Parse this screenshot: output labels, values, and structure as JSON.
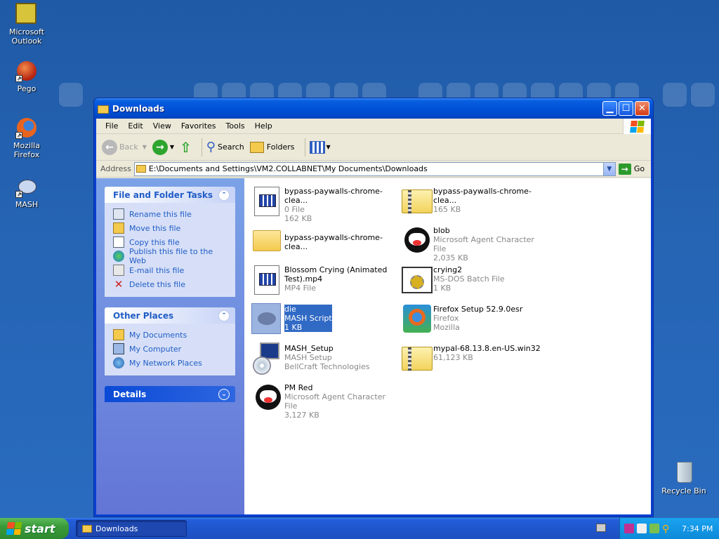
{
  "desktop": {
    "icons": [
      {
        "label": "Microsoft Outlook"
      },
      {
        "label": "Pego"
      },
      {
        "label": "Mozilla Firefox"
      },
      {
        "label": "MASH"
      },
      {
        "label": "Recycle Bin"
      }
    ]
  },
  "window": {
    "title": "Downloads",
    "menu": [
      "File",
      "Edit",
      "View",
      "Favorites",
      "Tools",
      "Help"
    ],
    "toolbar": {
      "back": "Back",
      "search": "Search",
      "folders": "Folders"
    },
    "address": {
      "label": "Address",
      "value": "E:\\Documents and Settings\\VM2.COLLABNET\\My Documents\\Downloads",
      "go": "Go"
    },
    "taskpane": {
      "file_tasks": {
        "title": "File and Folder Tasks",
        "items": [
          "Rename this file",
          "Move this file",
          "Copy this file",
          "Publish this file to the Web",
          "E-mail this file",
          "Delete this file"
        ]
      },
      "other_places": {
        "title": "Other Places",
        "items": [
          "My Documents",
          "My Computer",
          "My Network Places"
        ]
      },
      "details": {
        "title": "Details"
      }
    },
    "files": [
      {
        "name": "bypass-paywalls-chrome-clea...",
        "type": "0 File",
        "size": "162 KB",
        "icon": "document-icon"
      },
      {
        "name": "bypass-paywalls-chrome-clea...",
        "type": "165 KB",
        "size": "",
        "icon": "zip-folder-icon"
      },
      {
        "name": "bypass-paywalls-chrome-clea...",
        "type": "",
        "size": "",
        "icon": "folder-icon"
      },
      {
        "name": "blob",
        "type": "Microsoft Agent Character File",
        "size": "2,035 KB",
        "icon": "agent-character-icon"
      },
      {
        "name": "Blossom Crying (Animated Test).mp4",
        "type": "MP4 File",
        "size": "",
        "icon": "document-icon"
      },
      {
        "name": "crying2",
        "type": "MS-DOS Batch File",
        "size": "1 KB",
        "icon": "batch-file-icon"
      },
      {
        "name": "die",
        "type": "MASH Script",
        "size": "1 KB",
        "icon": "mash-script-icon"
      },
      {
        "name": "Firefox Setup 52.9.0esr",
        "type": "Firefox",
        "size": "Mozilla",
        "icon": "firefox-setup-icon"
      },
      {
        "name": "MASH_Setup",
        "type": "MASH Setup",
        "size": "BellCraft Technologies",
        "icon": "setup-icon"
      },
      {
        "name": "mypal-68.13.8.en-US.win32",
        "type": "61,123 KB",
        "size": "",
        "icon": "zip-folder-icon"
      },
      {
        "name": "PM Red",
        "type": "Microsoft Agent Character File",
        "size": "3,127 KB",
        "icon": "agent-character-icon"
      }
    ]
  },
  "taskbar": {
    "start": "start",
    "task": "Downloads",
    "clock": "7:34 PM"
  },
  "colors": {
    "accent": "#316ac5",
    "taskpane_link": "#215dc6"
  }
}
